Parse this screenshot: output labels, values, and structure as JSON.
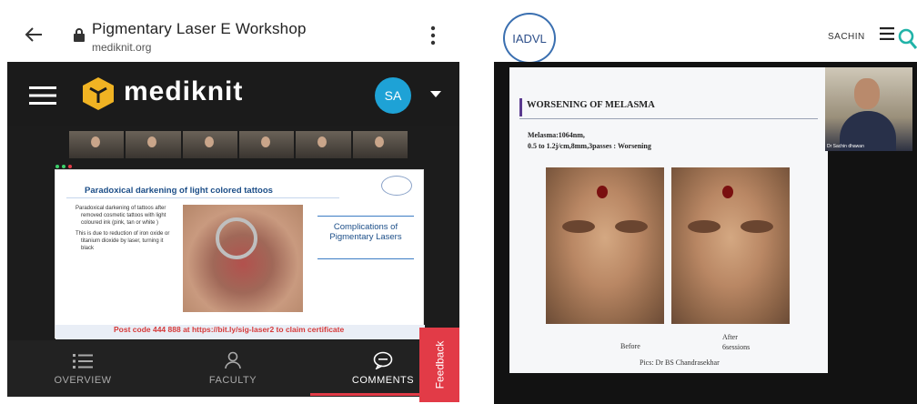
{
  "left": {
    "browser": {
      "title": "Pigmentary Laser E Workshop",
      "url": "mediknit.org"
    },
    "app": {
      "brand": "mediknit",
      "avatar_initials": "SA",
      "avatar_color": "#1ea2d6"
    },
    "slide": {
      "title": "Paradoxical darkening of light colored tattoos",
      "bullets": [
        "Paradoxical darkening of tattoos after removed cosmetic tattoos with light coloured ink (pink, tan or white )",
        "This is due to reduction of iron oxide or titanium dioxide by laser, turning it black"
      ],
      "side_box": "Complications of Pigmentary Lasers",
      "ticker": "Post code 444 888 at https://bit.ly/sig-laser2 to claim certificate"
    },
    "tabs": {
      "overview": "OVERVIEW",
      "faculty": "FACULTY",
      "comments": "COMMENTS"
    },
    "feedback_label": "Feedback",
    "accent_color": "#e23b47"
  },
  "right": {
    "header": {
      "logo_text": "IADVL",
      "user_name": "SACHIN"
    },
    "slide": {
      "title": "WORSENING OF MELASMA",
      "line1": "Melasma:1064nm,",
      "line2": "0.5 to 1.2j/cm,8mm,3passes : Worsening",
      "label_before": "Before",
      "label_after_1": "After",
      "label_after_2": "6sessions",
      "credit": "Pics: Dr BS Chandrasekhar"
    },
    "presenter_name": "Dr Sachin dhawan"
  }
}
